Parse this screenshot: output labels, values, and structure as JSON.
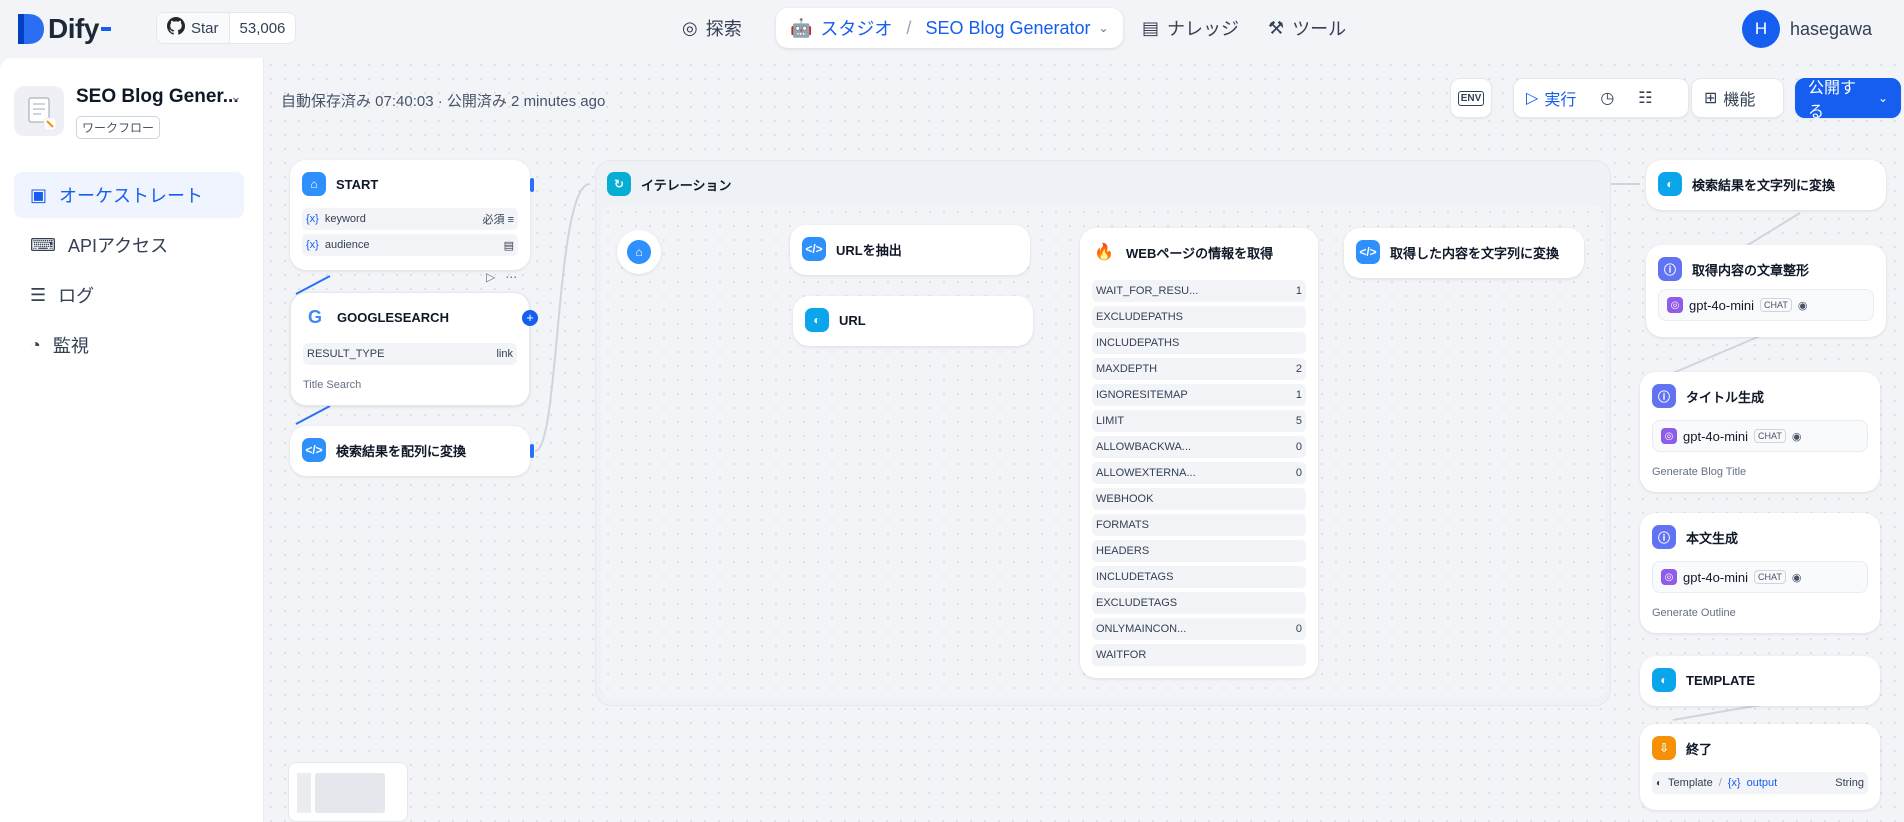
{
  "app_brand": "Dify",
  "github": {
    "star_label": "Star",
    "star_count": "53,006"
  },
  "nav": {
    "explore": "探索",
    "studio": "スタジオ",
    "app_name": "SEO Blog Generator",
    "knowledge": "ナレッジ",
    "tools": "ツール"
  },
  "user": {
    "initial": "H",
    "name": "hasegawa"
  },
  "sidebar": {
    "app_title": "SEO Blog Gener...",
    "app_type": "ワークフロー",
    "items": [
      {
        "label": "オーケストレート"
      },
      {
        "label": "APIアクセス"
      },
      {
        "label": "ログ"
      },
      {
        "label": "監視"
      }
    ]
  },
  "status": {
    "saved": "自動保存済み 07:40:03 · 公開済み 2 minutes ago"
  },
  "toolbar": {
    "env": "ENV",
    "run": "実行",
    "features": "機能",
    "publish": "公開する"
  },
  "nodes": {
    "start": {
      "title": "START",
      "vars": [
        {
          "name": "keyword",
          "badge": "必須"
        },
        {
          "name": "audience",
          "badge": ""
        }
      ]
    },
    "google": {
      "title": "GOOGLESEARCH",
      "param_key": "RESULT_TYPE",
      "param_value": "link",
      "desc": "Title Search"
    },
    "to_array": {
      "title": "検索結果を配列に変換"
    },
    "iteration": {
      "title": "イテレーション"
    },
    "extract_url": {
      "title": "URLを抽出"
    },
    "url": {
      "title": "URL"
    },
    "web": {
      "title": "WEBページの情報を取得",
      "params": [
        {
          "k": "WAIT_FOR_RESU...",
          "v": "1"
        },
        {
          "k": "EXCLUDEPATHS",
          "v": ""
        },
        {
          "k": "INCLUDEPATHS",
          "v": ""
        },
        {
          "k": "MAXDEPTH",
          "v": "2"
        },
        {
          "k": "IGNORESITEMAP",
          "v": "1"
        },
        {
          "k": "LIMIT",
          "v": "5"
        },
        {
          "k": "ALLOWBACKWA...",
          "v": "0"
        },
        {
          "k": "ALLOWEXTERNA...",
          "v": "0"
        },
        {
          "k": "WEBHOOK",
          "v": ""
        },
        {
          "k": "FORMATS",
          "v": ""
        },
        {
          "k": "HEADERS",
          "v": ""
        },
        {
          "k": "INCLUDETAGS",
          "v": ""
        },
        {
          "k": "EXCLUDETAGS",
          "v": ""
        },
        {
          "k": "ONLYMAINCON...",
          "v": "0"
        },
        {
          "k": "WAITFOR",
          "v": ""
        }
      ]
    },
    "to_string_inner": {
      "title": "取得した内容を文字列に変換"
    },
    "search_to_string": {
      "title": "検索結果を文字列に変換"
    },
    "format_content": {
      "title": "取得内容の文章整形",
      "model": "gpt-4o-mini",
      "mode": "CHAT"
    },
    "title_gen": {
      "title": "タイトル生成",
      "model": "gpt-4o-mini",
      "mode": "CHAT",
      "desc": "Generate Blog Title"
    },
    "body_gen": {
      "title": "本文生成",
      "model": "gpt-4o-mini",
      "mode": "CHAT",
      "desc": "Generate Outline"
    },
    "template": {
      "title": "TEMPLATE"
    },
    "end": {
      "title": "終了",
      "src": "Template",
      "var": "output",
      "type": "String"
    }
  },
  "colors": {
    "accent": "#155eef",
    "canvas": "#f2f4f7"
  }
}
